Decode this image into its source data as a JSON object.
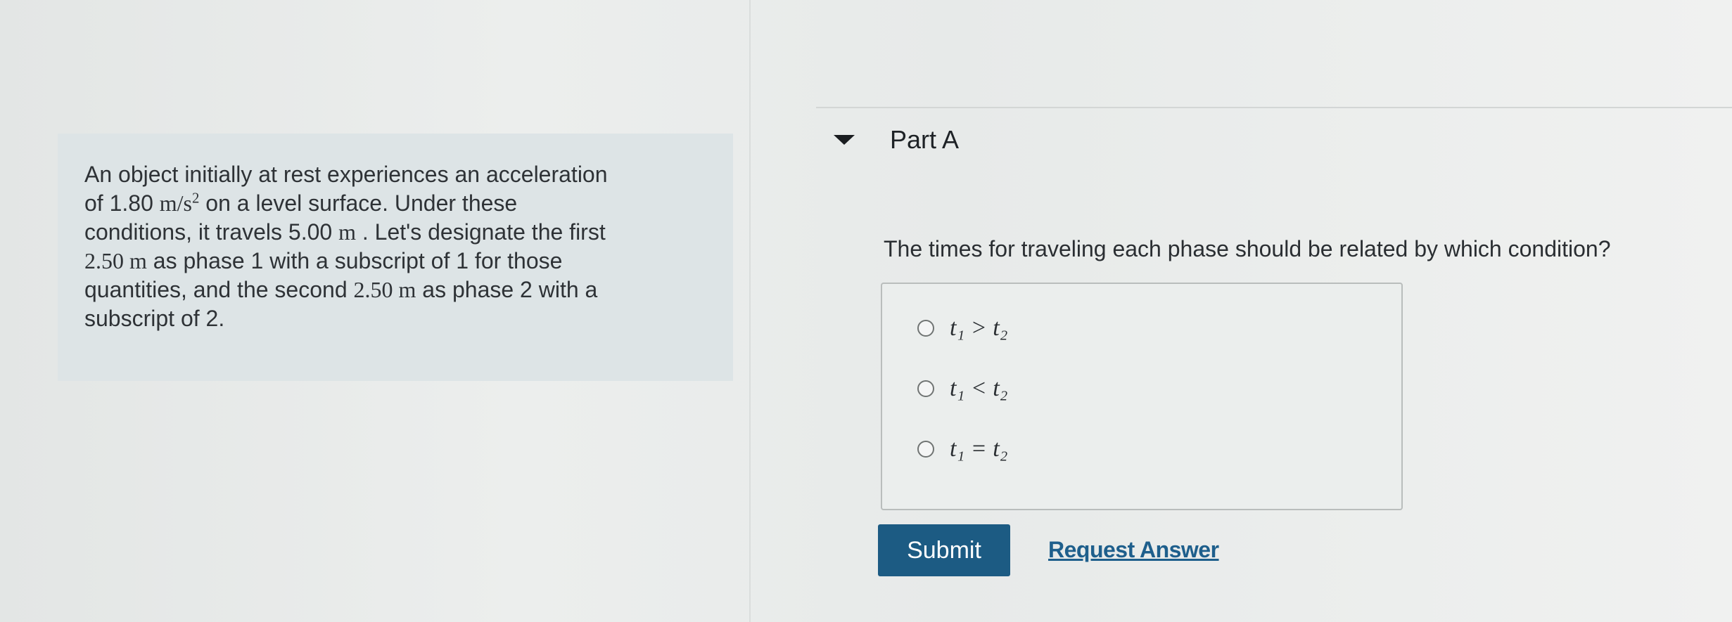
{
  "problem": {
    "line1": "An object initially at rest experiences an acceleration",
    "line2_pre": "of 1.80 ",
    "line2_unit": "m/s",
    "line2_exp": "2",
    "line2_post": " on a level surface. Under these",
    "line3_pre": "conditions, it travels 5.00 ",
    "line3_unit": "m",
    "line3_post": " . Let's designate the first",
    "line4_val": "2.50 m",
    "line4_post": " as phase 1 with a subscript of 1 for those",
    "line5_pre": "quantities, and the second ",
    "line5_val": "2.50 m",
    "line5_post": " as phase 2 with a",
    "line6": "subscript of 2."
  },
  "part": {
    "title": "Part A",
    "question": "The times for traveling each phase should be related by which condition?"
  },
  "options": [
    {
      "label": "t₁ > t₂"
    },
    {
      "label": "t₁ < t₂"
    },
    {
      "label": "t₁ = t₂"
    }
  ],
  "actions": {
    "submit_label": "Submit",
    "request_answer_label": "Request Answer"
  },
  "colors": {
    "submit_bg": "#1c5b83",
    "link": "#1e5f8c",
    "panel_bg": "#dde4e6"
  },
  "icons": {
    "caret": "caret-down-icon",
    "radio": "radio-icon"
  }
}
